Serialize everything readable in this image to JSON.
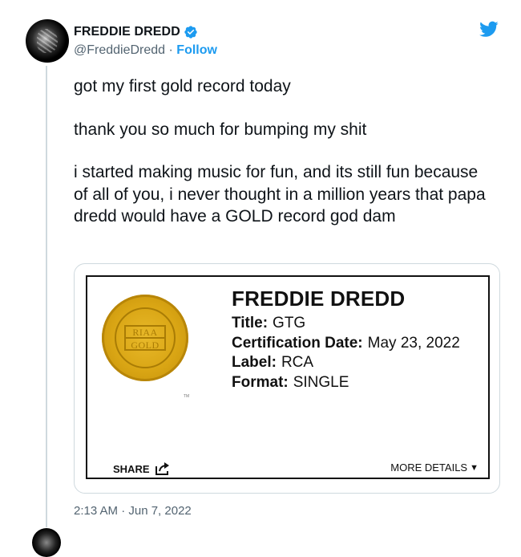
{
  "tweet": {
    "display_name": "FREDDIE DREDD",
    "handle": "@FreddieDredd",
    "separator": " · ",
    "follow_label": "Follow",
    "paragraphs": [
      "got my first gold record today",
      "thank you so much for bumping my shit",
      "i started making music for fun, and its still fun because of all of you, i never thought in a million years that papa dredd would have a GOLD record god dam"
    ],
    "timestamp": "2:13 AM · Jun 7, 2022"
  },
  "certificate": {
    "badge_top": "RIAA",
    "badge_bottom": "GOLD",
    "badge_tm": "TM",
    "artist": "FREDDIE DREDD",
    "fields": [
      {
        "label": "Title:",
        "value": "GTG"
      },
      {
        "label": "Certification Date:",
        "value": "May 23, 2022"
      },
      {
        "label": "Label:",
        "value": "RCA"
      },
      {
        "label": "Format:",
        "value": "SINGLE"
      }
    ],
    "share_label": "SHARE",
    "more_label": "MORE DETAILS",
    "more_arrow": "▼"
  },
  "icons": {
    "verified": "verified-badge-icon",
    "twitter": "twitter-bird-icon",
    "share": "share-icon"
  },
  "colors": {
    "accent": "#1d9bf0",
    "secondary_text": "#536471",
    "gold": "#d9a514"
  }
}
